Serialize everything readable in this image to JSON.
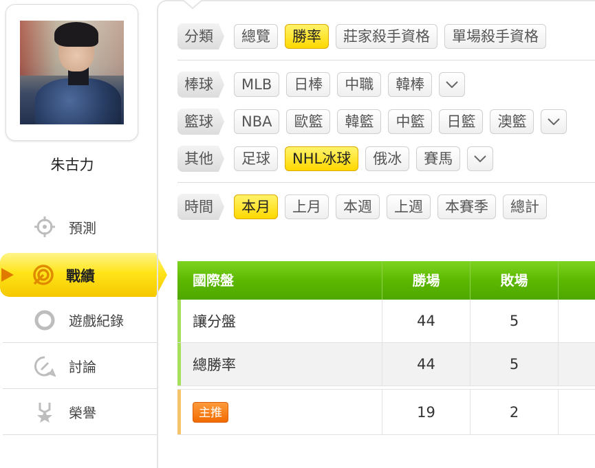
{
  "user": {
    "name": "朱古力"
  },
  "nav": [
    {
      "label": "預測",
      "icon": "crosshair-icon"
    },
    {
      "label": "戰績",
      "icon": "target-icon",
      "active": true
    },
    {
      "label": "遊戲紀錄",
      "icon": "ring-icon"
    },
    {
      "label": "討論",
      "icon": "chat-edit-icon"
    },
    {
      "label": "榮譽",
      "icon": "medal-icon"
    }
  ],
  "filters": {
    "category": {
      "label": "分類",
      "options": [
        "總覽",
        "勝率",
        "莊家殺手資格",
        "單場殺手資格"
      ],
      "selected": "勝率"
    },
    "baseball": {
      "label": "棒球",
      "options": [
        "MLB",
        "日棒",
        "中職",
        "韓棒"
      ]
    },
    "basketball": {
      "label": "籃球",
      "options": [
        "NBA",
        "歐籃",
        "韓籃",
        "中籃",
        "日籃",
        "澳籃"
      ]
    },
    "other": {
      "label": "其他",
      "options": [
        "足球",
        "NHL冰球",
        "俄冰",
        "賽馬"
      ],
      "selected": "NHL冰球"
    },
    "time": {
      "label": "時間",
      "options": [
        "本月",
        "上月",
        "本週",
        "上週",
        "本賽季",
        "總計"
      ],
      "selected": "本月"
    }
  },
  "table": {
    "headers": [
      "國際盤",
      "勝場",
      "敗場"
    ],
    "rows": [
      {
        "label": "讓分盤",
        "wins": "44",
        "losses": "5",
        "accent": "#a6e05a"
      },
      {
        "label": "總勝率",
        "wins": "44",
        "losses": "5",
        "accent": "#a6e05a"
      },
      {
        "badge": "主推",
        "wins": "19",
        "losses": "2",
        "accent": "#f5c36a"
      }
    ]
  },
  "colors": {
    "accent_yellow": "#ffe419",
    "header_green": "#5cb800",
    "badge_orange": "#f26b00"
  }
}
